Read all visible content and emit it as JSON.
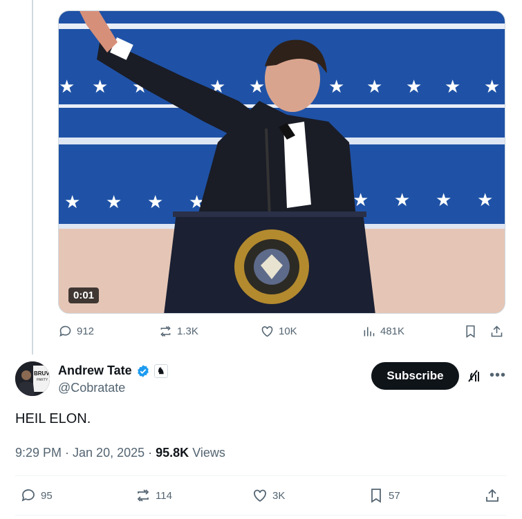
{
  "video": {
    "timestamp": "0:01",
    "seal_text": "SEAL OF THE PRESIDENT OF THE UNITED STATES"
  },
  "quoted_actions": {
    "replies": "912",
    "reposts": "1.3K",
    "likes": "10K",
    "views": "481K"
  },
  "author": {
    "name": "Andrew Tate",
    "handle": "@Cobratate",
    "avatar_text": "BRUV",
    "avatar_subtext": "PARTY"
  },
  "subscribe_label": "Subscribe",
  "tweet": {
    "text": "HEIL ELON.",
    "time": "9:29 PM · Jan 20, 2025 · ",
    "views_count": "95.8K",
    "views_label": "Views"
  },
  "actions": {
    "replies": "95",
    "reposts": "114",
    "likes": "3K",
    "bookmarks": "57"
  },
  "colors": {
    "text": "#0f1419",
    "secondary": "#536471",
    "verified": "#1d9bf0",
    "border": "#cfd9de"
  }
}
